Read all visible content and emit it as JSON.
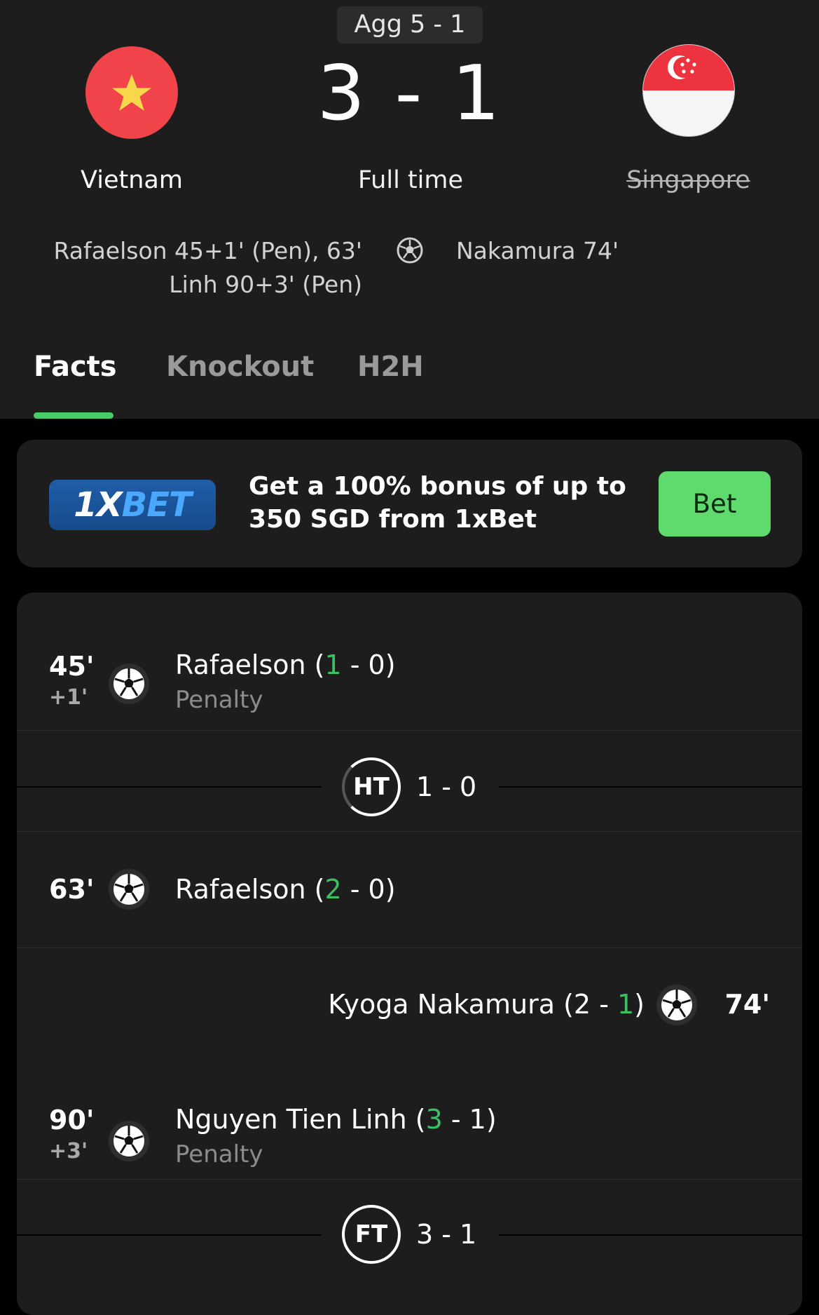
{
  "match": {
    "aggregate": "Agg 5 - 1",
    "score": "3 - 1",
    "status": "Full time",
    "home": {
      "name": "Vietnam",
      "flag_icon": "vietnam-flag-icon",
      "scorers_line1": "Rafaelson 45+1' (Pen), 63'",
      "scorers_line2": "Linh 90+3' (Pen)"
    },
    "away": {
      "name": "Singapore",
      "flag_icon": "singapore-flag-icon",
      "scorers_line1": "Nakamura 74'"
    }
  },
  "tabs": [
    {
      "label": "Facts",
      "active": true
    },
    {
      "label": "Knockout",
      "active": false
    },
    {
      "label": "H2H",
      "active": false
    }
  ],
  "ad": {
    "logo_part1": "1X",
    "logo_part2": "BET",
    "text": "Get a 100% bonus of up to 350 SGD from 1xBet",
    "button": "Bet"
  },
  "events": {
    "e1": {
      "minute": "45'",
      "extra": "+1'",
      "player": "Rafaelson",
      "score_open": " (",
      "score_hl": "1",
      "score_rest": " - 0)",
      "detail": "Penalty"
    },
    "ht": {
      "label": "HT",
      "score": "1 - 0"
    },
    "e2": {
      "minute": "63'",
      "player": "Rafaelson",
      "score_open": " (",
      "score_hl": "2",
      "score_rest": " - 0)"
    },
    "e3": {
      "minute": "74'",
      "player": "Kyoga Nakamura",
      "score_open": " (2 - ",
      "score_hl": "1",
      "score_rest": ")"
    },
    "e4": {
      "minute": "90'",
      "extra": "+3'",
      "player": "Nguyen Tien Linh",
      "score_open": " (",
      "score_hl": "3",
      "score_rest": " - 1)",
      "detail": "Penalty"
    },
    "ft": {
      "label": "FT",
      "score": "3 - 1"
    }
  },
  "colors": {
    "accent_green": "#47cc6a",
    "bet_button": "#5fdb6e",
    "highlight": "#3fbf63"
  }
}
